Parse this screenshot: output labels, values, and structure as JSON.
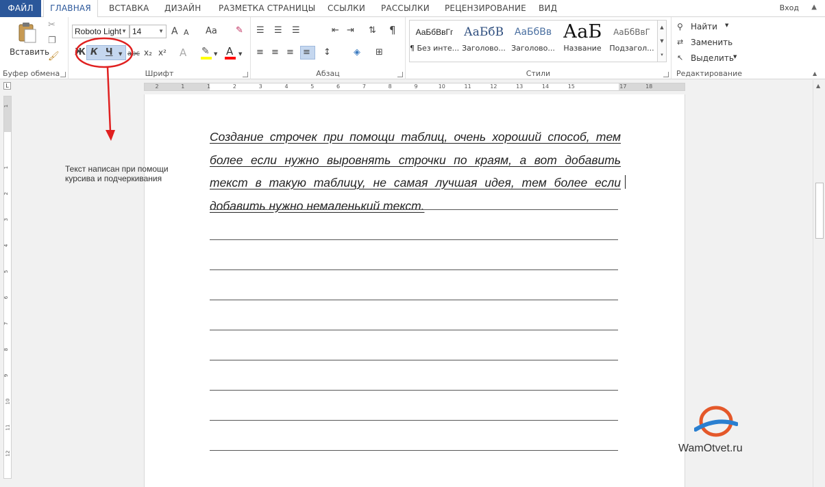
{
  "tabs": {
    "file": "ФАЙЛ",
    "items": [
      "ГЛАВНАЯ",
      "ВСТАВКА",
      "ДИЗАЙН",
      "РАЗМЕТКА СТРАНИЦЫ",
      "ССЫЛКИ",
      "РАССЫЛКИ",
      "РЕЦЕНЗИРОВАНИЕ",
      "ВИД"
    ],
    "signin": "Вход"
  },
  "ribbon": {
    "clipboard": {
      "label": "Буфер обмена",
      "paste": "Вставить"
    },
    "font": {
      "label": "Шрифт",
      "font_name": "Roboto Light",
      "font_size": "14",
      "bold": "Ж",
      "italic": "К",
      "underline": "Ч",
      "strike": "abc",
      "subscript": "x₂",
      "superscript": "x²",
      "case": "Aa",
      "grow": "A",
      "shrink": "A",
      "highlight_color": "#ffff00",
      "font_color": "#ff0000"
    },
    "paragraph": {
      "label": "Абзац",
      "pilcrow": "¶"
    },
    "styles": {
      "label": "Стили",
      "items": [
        {
          "sample": "АаБбВвГг",
          "name": "¶ Без инте..."
        },
        {
          "sample": "АаБбВ",
          "name": "Заголово..."
        },
        {
          "sample": "АаБбВв",
          "name": "Заголово..."
        },
        {
          "sample": "АаБ",
          "name": "Название"
        },
        {
          "sample": "АаБбВвГ",
          "name": "Подзагол..."
        }
      ]
    },
    "editing": {
      "label": "Редактирование",
      "find": "Найти",
      "replace": "Заменить",
      "select": "Выделить"
    }
  },
  "ruler": {
    "h_ticks": [
      "2",
      "1",
      "1",
      "2",
      "3",
      "4",
      "5",
      "6",
      "7",
      "8",
      "9",
      "10",
      "11",
      "12",
      "13",
      "14",
      "15",
      "17",
      "18"
    ],
    "v_ticks": [
      "1",
      "1",
      "2",
      "3",
      "4",
      "5",
      "6",
      "7",
      "8",
      "9",
      "10",
      "11",
      "12"
    ]
  },
  "document": {
    "body_text": "Создание строчек при помощи таблиц, очень хороший способ, тем более если нужно выровнять строчки по краям, а вот добавить текст в такую таблицу, не самая лучшая идея, тем более если добавить нужно немаленький текст.",
    "annotation": "Текст написан при помощи курсива и подчеркивания"
  },
  "watermark": {
    "brand": "WamOtvet.ru"
  },
  "colors": {
    "accent": "#2b579a",
    "highlight_box": "#c5d7ef",
    "callout": "#e02020"
  }
}
